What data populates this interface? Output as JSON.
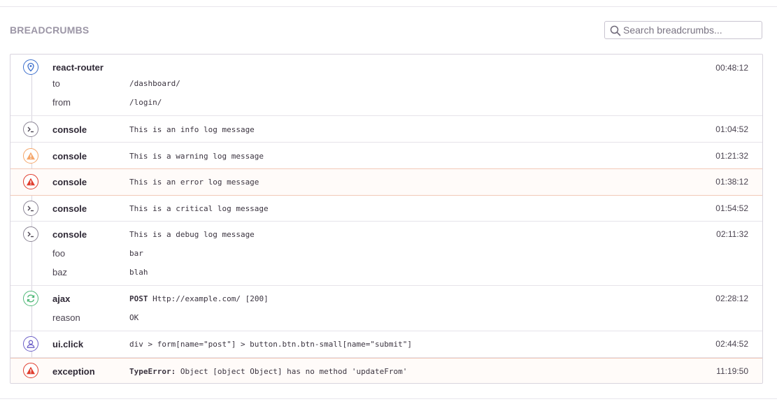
{
  "header": {
    "title": "BREADCRUMBS",
    "search_placeholder": "Search breadcrumbs..."
  },
  "crumbs": [
    {
      "category": "react-router",
      "time": "00:48:12",
      "icon": "location-pin-icon",
      "data": [
        {
          "key": "to",
          "value": "/dashboard/"
        },
        {
          "key": "from",
          "value": "/login/"
        }
      ]
    },
    {
      "category": "console",
      "message": "This is an info log message",
      "time": "01:04:52",
      "icon": "terminal-icon"
    },
    {
      "category": "console",
      "message": "This is a warning log message",
      "time": "01:21:32",
      "icon": "warning-icon"
    },
    {
      "category": "console",
      "message": "This is an error log message",
      "time": "01:38:12",
      "icon": "error-icon"
    },
    {
      "category": "console",
      "message": "This is a critical log message",
      "time": "01:54:52",
      "icon": "terminal-icon"
    },
    {
      "category": "console",
      "message": "This is a debug log message",
      "time": "02:11:32",
      "icon": "terminal-icon",
      "data": [
        {
          "key": "foo",
          "value": "bar"
        },
        {
          "key": "baz",
          "value": "blah"
        }
      ]
    },
    {
      "category": "ajax",
      "method": "POST",
      "url": "Http://example.com/ [200]",
      "time": "02:28:12",
      "icon": "refresh-icon",
      "data": [
        {
          "key": "reason",
          "value": "OK"
        }
      ]
    },
    {
      "category": "ui.click",
      "message": "div > form[name=\"post\"] > button.btn.btn-small[name=\"submit\"]",
      "time": "02:44:52",
      "icon": "user-icon"
    },
    {
      "category": "exception",
      "error_type": "TypeError:",
      "message": "Object [object Object] has no method 'updateFrom'",
      "time": "11:19:50",
      "icon": "error-icon"
    }
  ],
  "colors": {
    "heading": "#9c96a6",
    "navigation": "#3b6ecc",
    "warning": "#f5a66a",
    "error": "#e03e2f",
    "http": "#4fb877",
    "user": "#6c5fc7"
  }
}
